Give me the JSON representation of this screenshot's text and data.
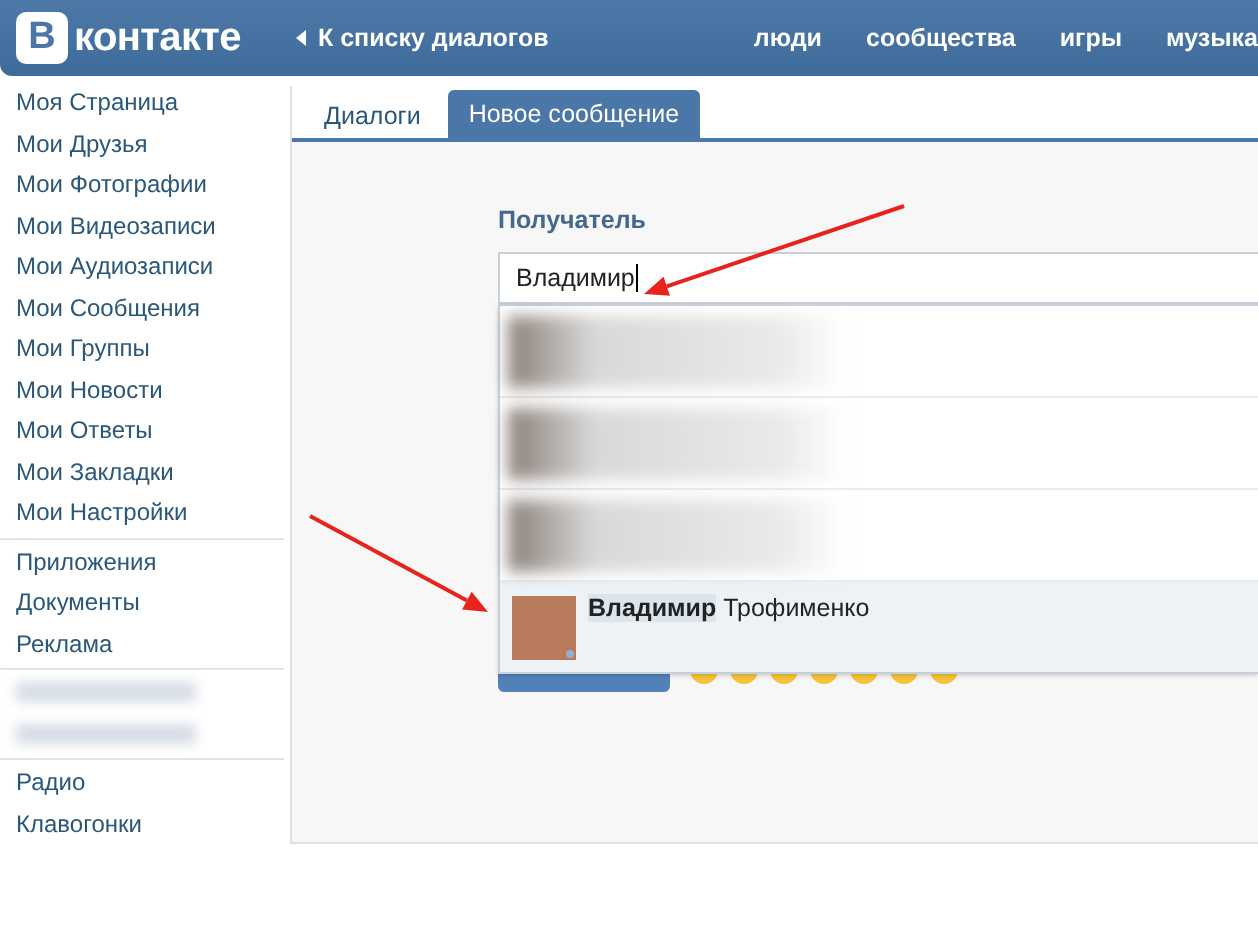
{
  "header": {
    "logo_mark": "В",
    "logo_text": "контакте",
    "back_link": "К списку диалогов",
    "nav": [
      "люди",
      "сообщества",
      "игры",
      "музыка"
    ]
  },
  "sidebar": {
    "groups": [
      [
        {
          "kind": "link",
          "label": "Моя Страница"
        },
        {
          "kind": "link",
          "label": "Мои Друзья"
        },
        {
          "kind": "link",
          "label": "Мои Фотографии"
        },
        {
          "kind": "link",
          "label": "Мои Видеозаписи"
        },
        {
          "kind": "link",
          "label": "Мои Аудиозаписи"
        },
        {
          "kind": "link",
          "label": "Мои Сообщения"
        },
        {
          "kind": "link",
          "label": "Мои Группы"
        },
        {
          "kind": "link",
          "label": "Мои Новости"
        },
        {
          "kind": "link",
          "label": "Мои Ответы"
        },
        {
          "kind": "link",
          "label": "Мои Закладки"
        },
        {
          "kind": "link",
          "label": "Мои Настройки"
        }
      ],
      [
        {
          "kind": "link",
          "label": "Приложения"
        },
        {
          "kind": "link",
          "label": "Документы"
        },
        {
          "kind": "link",
          "label": "Реклама"
        }
      ],
      [
        {
          "kind": "blurred"
        },
        {
          "kind": "blurred"
        }
      ],
      [
        {
          "kind": "link",
          "label": "Радио"
        },
        {
          "kind": "link",
          "label": "Клавогонки"
        }
      ]
    ]
  },
  "tabs": [
    {
      "label": "Диалоги",
      "selected": false
    },
    {
      "label": "Новое сообщение",
      "selected": true
    }
  ],
  "recipient": {
    "label": "Получатель",
    "value": "Владимир"
  },
  "suggestions": [
    {
      "kind": "blurred",
      "selected": false
    },
    {
      "kind": "blurred",
      "selected": false
    },
    {
      "kind": "blurred",
      "selected": false
    },
    {
      "kind": "person",
      "name": "**Владимир** Трофименко",
      "selected": true
    }
  ]
}
